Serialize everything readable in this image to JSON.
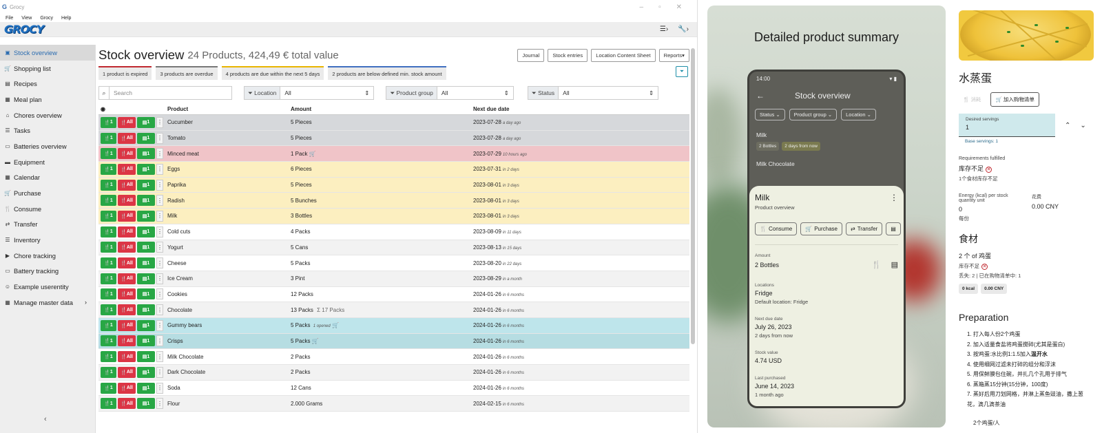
{
  "window": {
    "title": "Grocy",
    "menu": [
      "File",
      "View",
      "Grocy",
      "Help"
    ]
  },
  "app": {
    "logo": "GROCY"
  },
  "sidebar": {
    "items": [
      {
        "label": "Stock overview",
        "icon": "box-icon",
        "glyph": "▣",
        "active": true
      },
      {
        "label": "Shopping list",
        "icon": "cart-icon",
        "glyph": "🛒"
      },
      {
        "label": "Recipes",
        "icon": "paste-icon",
        "glyph": "▤"
      },
      {
        "label": "Meal plan",
        "icon": "calendar-week-icon",
        "glyph": "▦"
      },
      {
        "label": "Chores overview",
        "icon": "home-icon",
        "glyph": "⌂"
      },
      {
        "label": "Tasks",
        "icon": "tasks-icon",
        "glyph": "☰"
      },
      {
        "label": "Batteries overview",
        "icon": "battery-icon",
        "glyph": "▭"
      },
      {
        "label": "Equipment",
        "icon": "toolbox-icon",
        "glyph": "▬"
      },
      {
        "label": "Calendar",
        "icon": "calendar-icon",
        "glyph": "▦"
      },
      {
        "label": "Purchase",
        "icon": "cart-plus-icon",
        "glyph": "🛒"
      },
      {
        "label": "Consume",
        "icon": "utensils-icon",
        "glyph": "🍴"
      },
      {
        "label": "Transfer",
        "icon": "exchange-icon",
        "glyph": "⇄"
      },
      {
        "label": "Inventory",
        "icon": "list-icon",
        "glyph": "☰"
      },
      {
        "label": "Chore tracking",
        "icon": "play-icon",
        "glyph": "▶"
      },
      {
        "label": "Battery tracking",
        "icon": "battery-tracking-icon",
        "glyph": "▭"
      },
      {
        "label": "Example userentity",
        "icon": "smile-icon",
        "glyph": "☺"
      },
      {
        "label": "Manage master data",
        "icon": "table-icon",
        "glyph": "▦",
        "chevron": "›"
      }
    ],
    "collapse": "‹"
  },
  "main": {
    "title": "Stock overview",
    "subtitle": "24 Products, 424,49 € total value",
    "buttons": [
      "Journal",
      "Stock entries",
      "Location Content Sheet",
      "Reports▾"
    ],
    "alerts": [
      {
        "text": "1 product is expired",
        "kind": "r"
      },
      {
        "text": "3 products are overdue",
        "kind": "g"
      },
      {
        "text": "4 products are due within the next 5 days",
        "kind": "y"
      },
      {
        "text": "2 products are below defined min. stock amount",
        "kind": "b"
      }
    ],
    "search_placeholder": "Search",
    "filters": [
      {
        "label": "Location",
        "value": "All"
      },
      {
        "label": "Product group",
        "value": "All"
      },
      {
        "label": "Status",
        "value": "All"
      }
    ],
    "columns": [
      "Product",
      "Amount",
      "Next due date"
    ],
    "action_labels": {
      "consume1": "1",
      "consume_all": "All",
      "open1": "1"
    },
    "rows": [
      {
        "product": "Cucumber",
        "amount": "5 Pieces",
        "due": "2023-07-28",
        "rel": "a day ago",
        "bg": "grey"
      },
      {
        "product": "Tomato",
        "amount": "5 Pieces",
        "due": "2023-07-28",
        "rel": "a day ago",
        "bg": "grey"
      },
      {
        "product": "Minced meat",
        "amount": "1 Pack",
        "cart": true,
        "due": "2023-07-29",
        "rel": "10 hours ago",
        "bg": "red"
      },
      {
        "product": "Eggs",
        "amount": "6 Pieces",
        "due": "2023-07-31",
        "rel": "in 2 days",
        "bg": "yel"
      },
      {
        "product": "Paprika",
        "amount": "5 Pieces",
        "due": "2023-08-01",
        "rel": "in 3 days",
        "bg": "yel"
      },
      {
        "product": "Radish",
        "amount": "5 Bunches",
        "due": "2023-08-01",
        "rel": "in 3 days",
        "bg": "yel"
      },
      {
        "product": "Milk",
        "amount": "3 Bottles",
        "due": "2023-08-01",
        "rel": "in 3 days",
        "bg": "yel"
      },
      {
        "product": "Cold cuts",
        "amount": "4 Packs",
        "due": "2023-08-09",
        "rel": "in 11 days",
        "bg": "w1"
      },
      {
        "product": "Yogurt",
        "amount": "5 Cans",
        "due": "2023-08-13",
        "rel": "in 15 days",
        "bg": "w2"
      },
      {
        "product": "Cheese",
        "amount": "5 Packs",
        "due": "2023-08-20",
        "rel": "in 22 days",
        "bg": "w1"
      },
      {
        "product": "Ice Cream",
        "amount": "3 Pint",
        "due": "2023-08-29",
        "rel": "in a month",
        "bg": "w2"
      },
      {
        "product": "Cookies",
        "amount": "12 Packs",
        "due": "2024-01-26",
        "rel": "in 6 months",
        "bg": "w1"
      },
      {
        "product": "Chocolate",
        "amount": "13 Packs",
        "sum": "Σ 17 Packs",
        "due": "2024-01-26",
        "rel": "in 6 months",
        "bg": "w2"
      },
      {
        "product": "Gummy bears",
        "amount": "5 Packs",
        "opened": "1 opened",
        "cart": true,
        "due": "2024-01-26",
        "rel": "in 6 months",
        "bg": "cyan"
      },
      {
        "product": "Crisps",
        "amount": "5 Packs",
        "cart": true,
        "due": "2024-01-26",
        "rel": "in 6 months",
        "bg": "cyan2"
      },
      {
        "product": "Milk Chocolate",
        "amount": "2 Packs",
        "due": "2024-01-26",
        "rel": "in 6 months",
        "bg": "w1"
      },
      {
        "product": "Dark Chocolate",
        "amount": "2 Packs",
        "due": "2024-01-26",
        "rel": "in 6 months",
        "bg": "w2"
      },
      {
        "product": "Soda",
        "amount": "12 Cans",
        "due": "2024-01-26",
        "rel": "in 6 months",
        "bg": "w1"
      },
      {
        "product": "Flour",
        "amount": "2.000 Grams",
        "due": "2024-02-15",
        "rel": "in 6 months",
        "bg": "w2"
      }
    ]
  },
  "phone": {
    "heading": "Detailed product summary",
    "time": "14:00",
    "screen_title": "Stock overview",
    "chips": [
      "Status",
      "Product group",
      "Location"
    ],
    "list": [
      {
        "name": "Milk",
        "tags": [
          "2 Bottles",
          "2 days from now"
        ]
      },
      {
        "name": "Milk Chocolate"
      }
    ],
    "sheet": {
      "title": "Milk",
      "subtitle": "Product overview",
      "buttons": [
        "Consume",
        "Purchase",
        "Transfer"
      ],
      "amount_label": "Amount",
      "amount": "2 Bottles",
      "locations_label": "Locations",
      "location": "Fridge",
      "default_location": "Default location: Fridge",
      "due_label": "Next due date",
      "due": "July 26, 2023",
      "due_rel": "2 days from now",
      "value_label": "Stock value",
      "value": "4.74 USD",
      "purchased_label": "Last purchased",
      "purchased": "June 14, 2023",
      "purchased_rel": "1 month ago"
    }
  },
  "recipe": {
    "title": "水蒸蛋",
    "consume": "消耗",
    "add_to_list": "加入购物清单",
    "servings_label": "Desired servings",
    "servings": "1",
    "base_servings": "Base servings: 1",
    "req_label": "Requirements fulfilled",
    "req_value": "库存不足",
    "req_sub": "1个食材库存不足",
    "energy_label": "Energy (kcal) per stock quantity unit",
    "energy_value": "0",
    "energy_sub": "每份",
    "cost_label": "花费",
    "cost_value": "0.00 CNY",
    "ingredients_title": "食材",
    "ingredient": "2 个 of 鸡蛋",
    "ingredient_status": "库存不足",
    "ingredient_note": "丢失: 2 | 已在购物清单中: 1",
    "chips": [
      "0 kcal",
      "0.00 CNY"
    ],
    "prep_title": "Preparation",
    "steps": [
      "1. 打入每人份2个鸡蛋",
      "2. 加入适量食盐将鸡蛋搅碎(尤其是蛋白)",
      "3. 按鸡蛋:水比例1:1.5加入",
      "4. 使用细网过滤未打碎的组分和浮沫",
      "5. 用保鲜膜包住碗，并扎几个孔用于排气",
      "6. 蒸箱蒸15分钟(15分钟，100度)",
      "7. 蒸好后用刀划网格，并淋上蒸鱼豉油，撒上葱花，滴几滴茶油"
    ],
    "step3_bold": "温开水",
    "serving_note": "2个鸡蛋/人"
  }
}
